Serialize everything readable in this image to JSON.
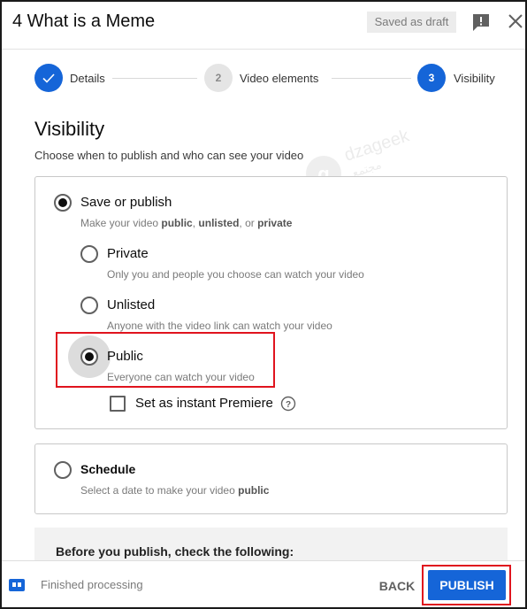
{
  "header": {
    "title": "4 What is a Meme",
    "draft_status": "Saved as draft",
    "feedback_icon": "feedback-icon",
    "close_icon": "close-icon"
  },
  "stepper": {
    "steps": [
      {
        "badge": "✓",
        "label": "Details",
        "state": "done"
      },
      {
        "badge": "2",
        "label": "Video elements",
        "state": "pending"
      },
      {
        "badge": "3",
        "label": "Visibility",
        "state": "active"
      }
    ]
  },
  "visibility": {
    "title": "Visibility",
    "description": "Choose when to publish and who can see your video"
  },
  "watermark": {
    "text": "dzageek",
    "sub": "مجتمع"
  },
  "save_or_publish": {
    "label": "Save or publish",
    "selected": true,
    "desc_prefix": "Make your video ",
    "desc_public": "public",
    "desc_sep1": ", ",
    "desc_unlisted": "unlisted",
    "desc_sep2": ", or ",
    "desc_private": "private",
    "options": [
      {
        "label": "Private",
        "description": "Only you and people you choose can watch your video",
        "selected": false
      },
      {
        "label": "Unlisted",
        "description": "Anyone with the video link can watch your video",
        "selected": false
      },
      {
        "label": "Public",
        "description": "Everyone can watch your video",
        "selected": true
      }
    ],
    "premiere": {
      "label": "Set as instant Premiere",
      "checked": false
    }
  },
  "schedule": {
    "label": "Schedule",
    "selected": false,
    "desc_prefix": "Select a date to make your video ",
    "desc_public": "public"
  },
  "checklist": {
    "title": "Before you publish, check the following:"
  },
  "footer": {
    "status": "Finished processing",
    "back_label": "BACK",
    "publish_label": "PUBLISH"
  },
  "colors": {
    "accent": "#1565d8",
    "highlight": "#e0141e"
  }
}
